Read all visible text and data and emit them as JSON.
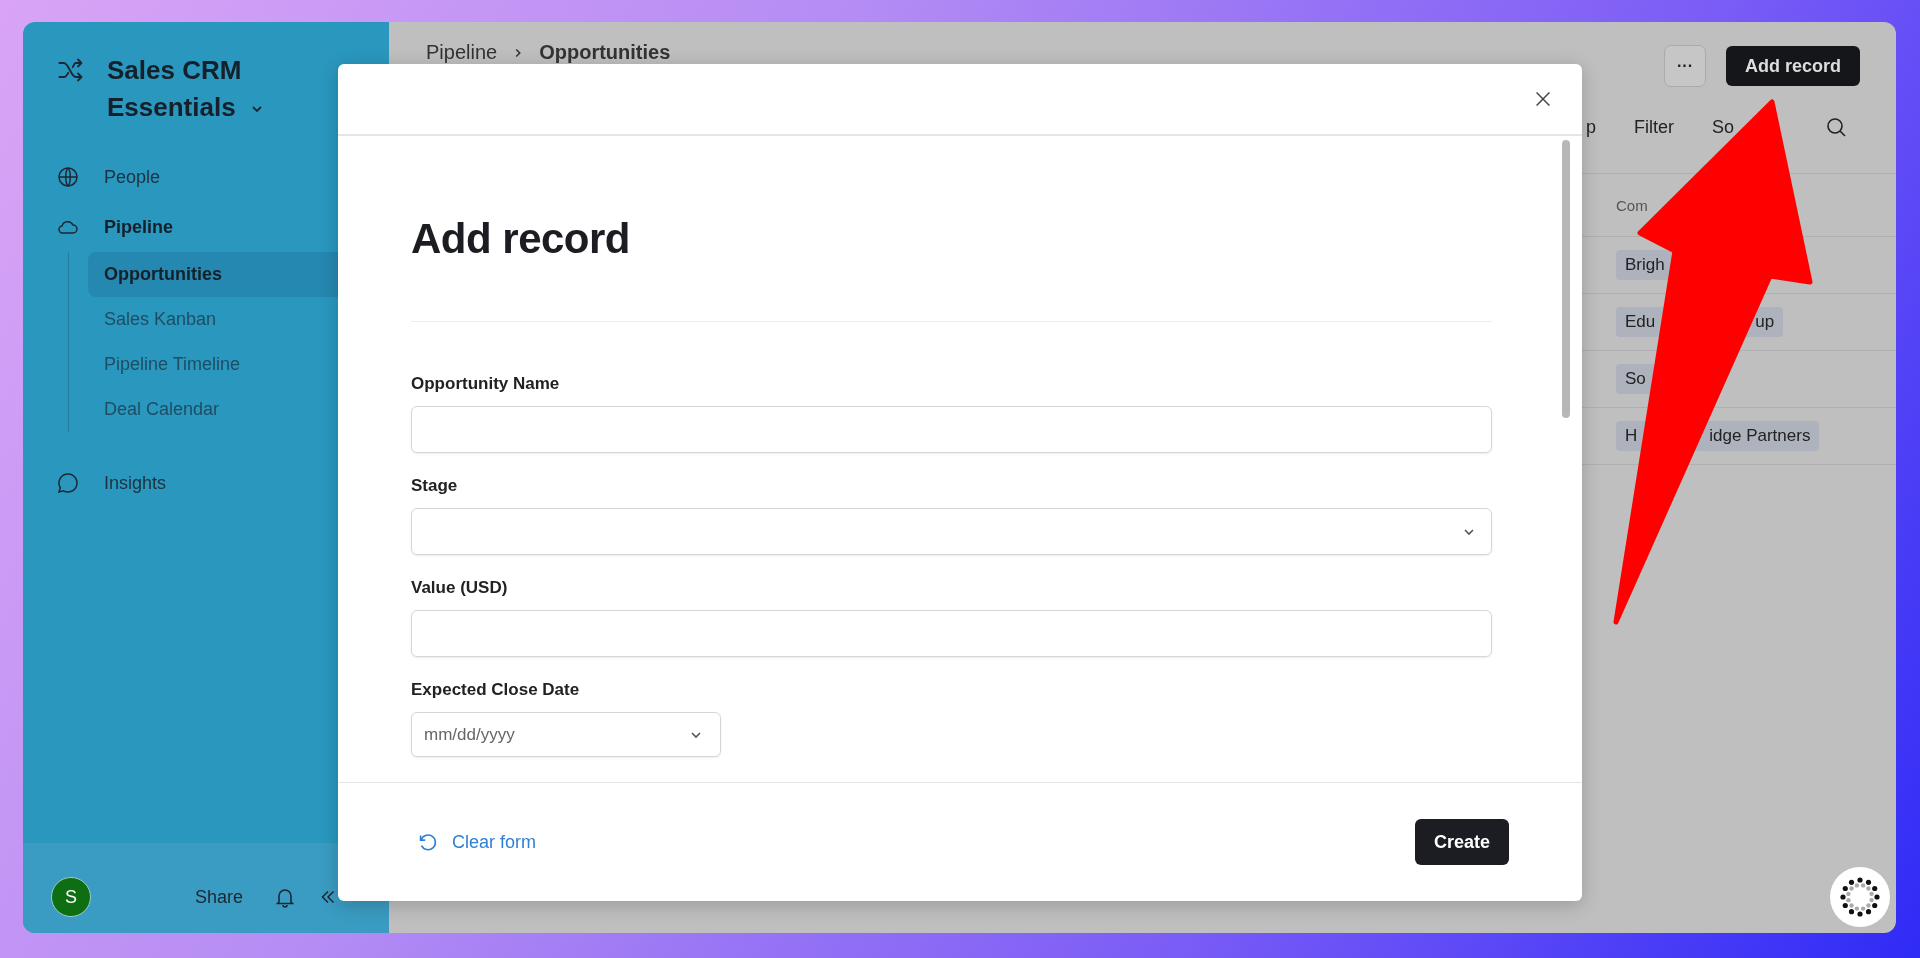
{
  "sidebar": {
    "workspace": "Sales CRM Essentials",
    "items": [
      {
        "label": "People",
        "selected": false
      },
      {
        "label": "Pipeline",
        "selected": false,
        "expanded": true,
        "children": [
          {
            "label": "Opportunities",
            "selected": true
          },
          {
            "label": "Sales Kanban",
            "selected": false
          },
          {
            "label": "Pipeline Timeline",
            "selected": false
          },
          {
            "label": "Deal Calendar",
            "selected": false
          }
        ]
      },
      {
        "label": "Insights",
        "selected": false
      }
    ],
    "footer": {
      "avatar": "S",
      "share": "Share"
    }
  },
  "header": {
    "breadcrumb": [
      "Pipeline",
      "Opportunities"
    ],
    "more": "···",
    "add_button": "Add record"
  },
  "toolbar": [
    "p",
    "Filter",
    "So"
  ],
  "table": {
    "columns": [
      "Com"
    ],
    "rows": [
      {
        "company": "Brigh"
      },
      {
        "company": "Edu",
        "tail": "up"
      },
      {
        "company": "So"
      },
      {
        "company": "H",
        "tail": "idge Partners"
      }
    ]
  },
  "modal": {
    "title": "Add record",
    "fields": [
      {
        "label": "Opportunity Name",
        "kind": "text"
      },
      {
        "label": "Stage",
        "kind": "select"
      },
      {
        "label": "Value (USD)",
        "kind": "text"
      },
      {
        "label": "Expected Close Date",
        "kind": "date",
        "placeholder": "mm/dd/yyyy"
      }
    ],
    "clear": "Clear form",
    "submit": "Create"
  }
}
